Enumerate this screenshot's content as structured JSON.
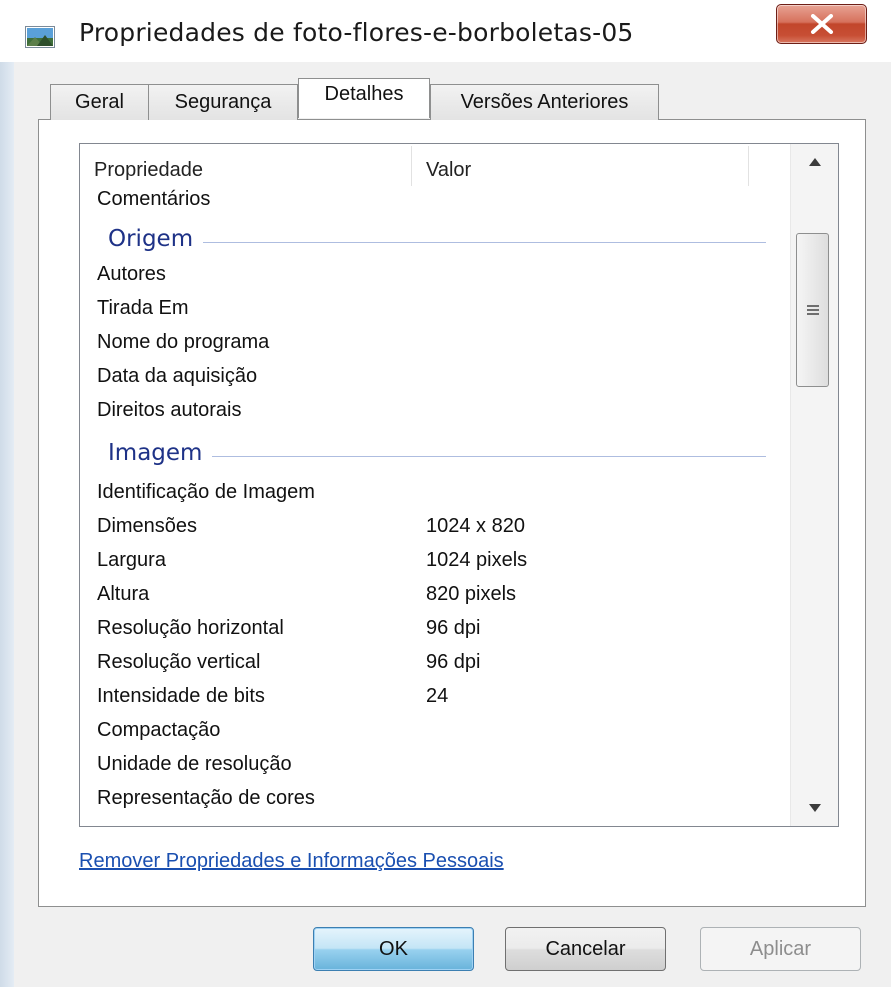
{
  "window": {
    "title": "Propriedades de foto-flores-e-borboletas-05",
    "icon": "image-file-icon",
    "close_icon": "close-icon"
  },
  "tabs": [
    {
      "label": "Geral",
      "active": false
    },
    {
      "label": "Segurança",
      "active": false
    },
    {
      "label": "Detalhes",
      "active": true
    },
    {
      "label": "Versões Anteriores",
      "active": false
    }
  ],
  "details": {
    "columns": {
      "property": "Propriedade",
      "value": "Valor"
    },
    "partial_row": "Comentários",
    "groups": [
      {
        "title": "Origem",
        "rows": [
          {
            "name": "Autores",
            "value": ""
          },
          {
            "name": "Tirada Em",
            "value": ""
          },
          {
            "name": "Nome do programa",
            "value": ""
          },
          {
            "name": "Data da aquisição",
            "value": ""
          },
          {
            "name": "Direitos autorais",
            "value": ""
          }
        ]
      },
      {
        "title": "Imagem",
        "rows": [
          {
            "name": "Identificação de Imagem",
            "value": ""
          },
          {
            "name": "Dimensões",
            "value": "1024 x 820"
          },
          {
            "name": "Largura",
            "value": "1024 pixels"
          },
          {
            "name": "Altura",
            "value": "820 pixels"
          },
          {
            "name": "Resolução horizontal",
            "value": "96 dpi"
          },
          {
            "name": "Resolução vertical",
            "value": "96 dpi"
          },
          {
            "name": "Intensidade de bits",
            "value": "24"
          },
          {
            "name": "Compactação",
            "value": ""
          },
          {
            "name": "Unidade de resolução",
            "value": ""
          },
          {
            "name": "Representação de cores",
            "value": ""
          }
        ]
      }
    ]
  },
  "remove_link": "Remover Propriedades e Informações Pessoais",
  "buttons": {
    "ok": "OK",
    "cancel": "Cancelar",
    "apply": "Aplicar"
  },
  "colors": {
    "group_heading": "#1e3287",
    "link": "#1a4fb0",
    "close_button": "#c74e34"
  }
}
